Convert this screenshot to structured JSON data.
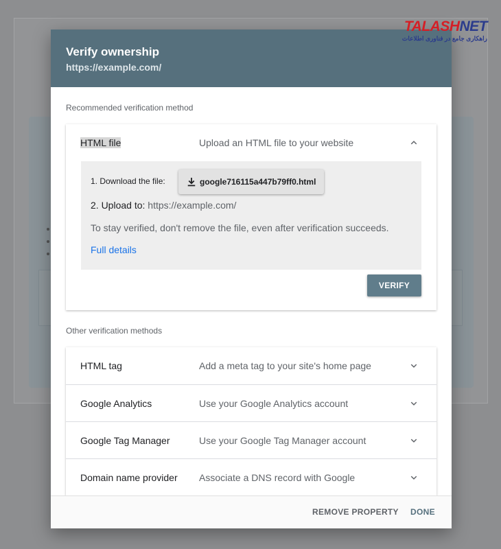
{
  "watermark": {
    "brand_part1": "TALASH",
    "brand_part2": "NET",
    "tagline": "راهکاری جامع در فناوری اطلاعات"
  },
  "dialog": {
    "title": "Verify ownership",
    "subtitle": "https://example.com/"
  },
  "recommended": {
    "section_label": "Recommended verification method",
    "method": {
      "name": "HTML file",
      "description": "Upload an HTML file to your website"
    },
    "details": {
      "step1_label": "1. Download the file:",
      "file_name": "google716115a447b79ff0.html",
      "step2_label": "2. Upload to:",
      "step2_url": "https://example.com/",
      "note": "To stay verified, don't remove the file, even after verification succeeds.",
      "link": "Full details"
    },
    "verify_label": "VERIFY"
  },
  "other": {
    "section_label": "Other verification methods",
    "methods": [
      {
        "name": "HTML tag",
        "description": "Add a meta tag to your site's home page"
      },
      {
        "name": "Google Analytics",
        "description": "Use your Google Analytics account"
      },
      {
        "name": "Google Tag Manager",
        "description": "Use your Google Tag Manager account"
      },
      {
        "name": "Domain name provider",
        "description": "Associate a DNS record with Google"
      }
    ]
  },
  "footer": {
    "remove_label": "REMOVE PROPERTY",
    "done_label": "DONE"
  },
  "colors": {
    "header": "#56707d",
    "verify_button": "#607d8b",
    "link": "#1a73e8"
  },
  "icons": {
    "expand": "chevron-down-icon",
    "collapse": "chevron-up-icon",
    "download": "download-icon"
  }
}
